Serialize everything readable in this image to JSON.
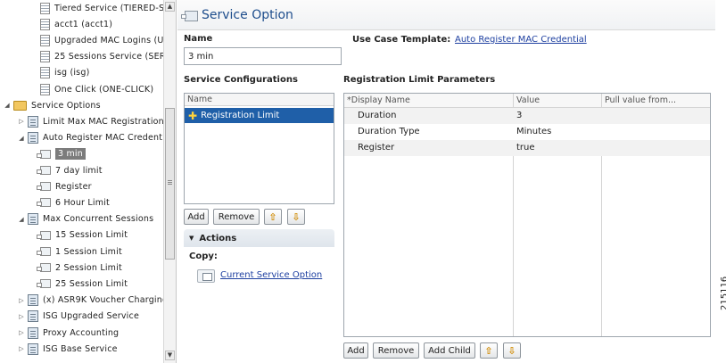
{
  "tree": {
    "items": [
      {
        "label": "Tiered Service (TIERED-SERV",
        "icon": "list-icon",
        "level": 2,
        "twisty": ""
      },
      {
        "label": "acct1 (acct1)",
        "icon": "list-icon",
        "level": 2,
        "twisty": ""
      },
      {
        "label": "Upgraded MAC Logins (UP-M",
        "icon": "list-icon",
        "level": 2,
        "twisty": ""
      },
      {
        "label": "25 Sessions Service (SERVIC",
        "icon": "list-icon",
        "level": 2,
        "twisty": ""
      },
      {
        "label": "isg (isg)",
        "icon": "list-icon",
        "level": 2,
        "twisty": ""
      },
      {
        "label": "One Click (ONE-CLICK)",
        "icon": "list-icon",
        "level": 2,
        "twisty": ""
      },
      {
        "label": "Service Options",
        "icon": "folder-icon",
        "level": 0,
        "twisty": "◢"
      },
      {
        "label": "Limit Max MAC Registrations",
        "icon": "service-icon",
        "level": 1,
        "twisty": "▷"
      },
      {
        "label": "Auto Register MAC Credentia",
        "icon": "service-icon",
        "level": 1,
        "twisty": "◢"
      },
      {
        "label": "3 min",
        "icon": "option-icon",
        "level": 2,
        "twisty": "",
        "selected": true
      },
      {
        "label": "7 day limit",
        "icon": "option-icon",
        "level": 2,
        "twisty": ""
      },
      {
        "label": "Register",
        "icon": "option-icon",
        "level": 2,
        "twisty": ""
      },
      {
        "label": "6 Hour Limit",
        "icon": "option-icon",
        "level": 2,
        "twisty": ""
      },
      {
        "label": "Max Concurrent Sessions",
        "icon": "service-icon",
        "level": 1,
        "twisty": "◢"
      },
      {
        "label": "15 Session Limit",
        "icon": "option-icon",
        "level": 2,
        "twisty": ""
      },
      {
        "label": "1 Session Limit",
        "icon": "option-icon",
        "level": 2,
        "twisty": ""
      },
      {
        "label": "2 Session Limit",
        "icon": "option-icon",
        "level": 2,
        "twisty": ""
      },
      {
        "label": "25 Session Limit",
        "icon": "option-icon",
        "level": 2,
        "twisty": ""
      },
      {
        "label": "(x) ASR9K Voucher Charging",
        "icon": "service-icon",
        "level": 1,
        "twisty": "▷"
      },
      {
        "label": "ISG Upgraded Service",
        "icon": "service-icon",
        "level": 1,
        "twisty": "▷"
      },
      {
        "label": "Proxy Accounting",
        "icon": "service-icon",
        "level": 1,
        "twisty": "▷"
      },
      {
        "label": "ISG Base Service",
        "icon": "service-icon",
        "level": 1,
        "twisty": "▷"
      }
    ],
    "scroll_up": "▲",
    "scroll_down": "▼"
  },
  "header": {
    "title": "Service Option",
    "icon": "service-option-icon"
  },
  "form": {
    "name_label": "Name",
    "name_value": "3 min",
    "use_case_label": "Use Case Template:",
    "use_case_link": "Auto Register MAC Credential"
  },
  "service_configs": {
    "title": "Service Configurations",
    "column": "Name",
    "row": "Registration Limit",
    "buttons": {
      "add": "Add",
      "remove": "Remove",
      "up": "⇧",
      "down": "⇩"
    }
  },
  "actions": {
    "title": "Actions",
    "copy_label": "Copy:",
    "copy_link": "Current Service Option"
  },
  "params": {
    "title": "Registration Limit Parameters",
    "columns": [
      "*Display Name",
      "Value",
      "Pull value from..."
    ],
    "rows": [
      {
        "name": "Duration",
        "value": "3"
      },
      {
        "name": "Duration Type",
        "value": "Minutes"
      },
      {
        "name": "Register",
        "value": "true"
      }
    ],
    "buttons": {
      "add": "Add",
      "remove": "Remove",
      "add_child": "Add Child",
      "up": "⇧",
      "down": "⇩"
    }
  },
  "figure_id": "215116"
}
